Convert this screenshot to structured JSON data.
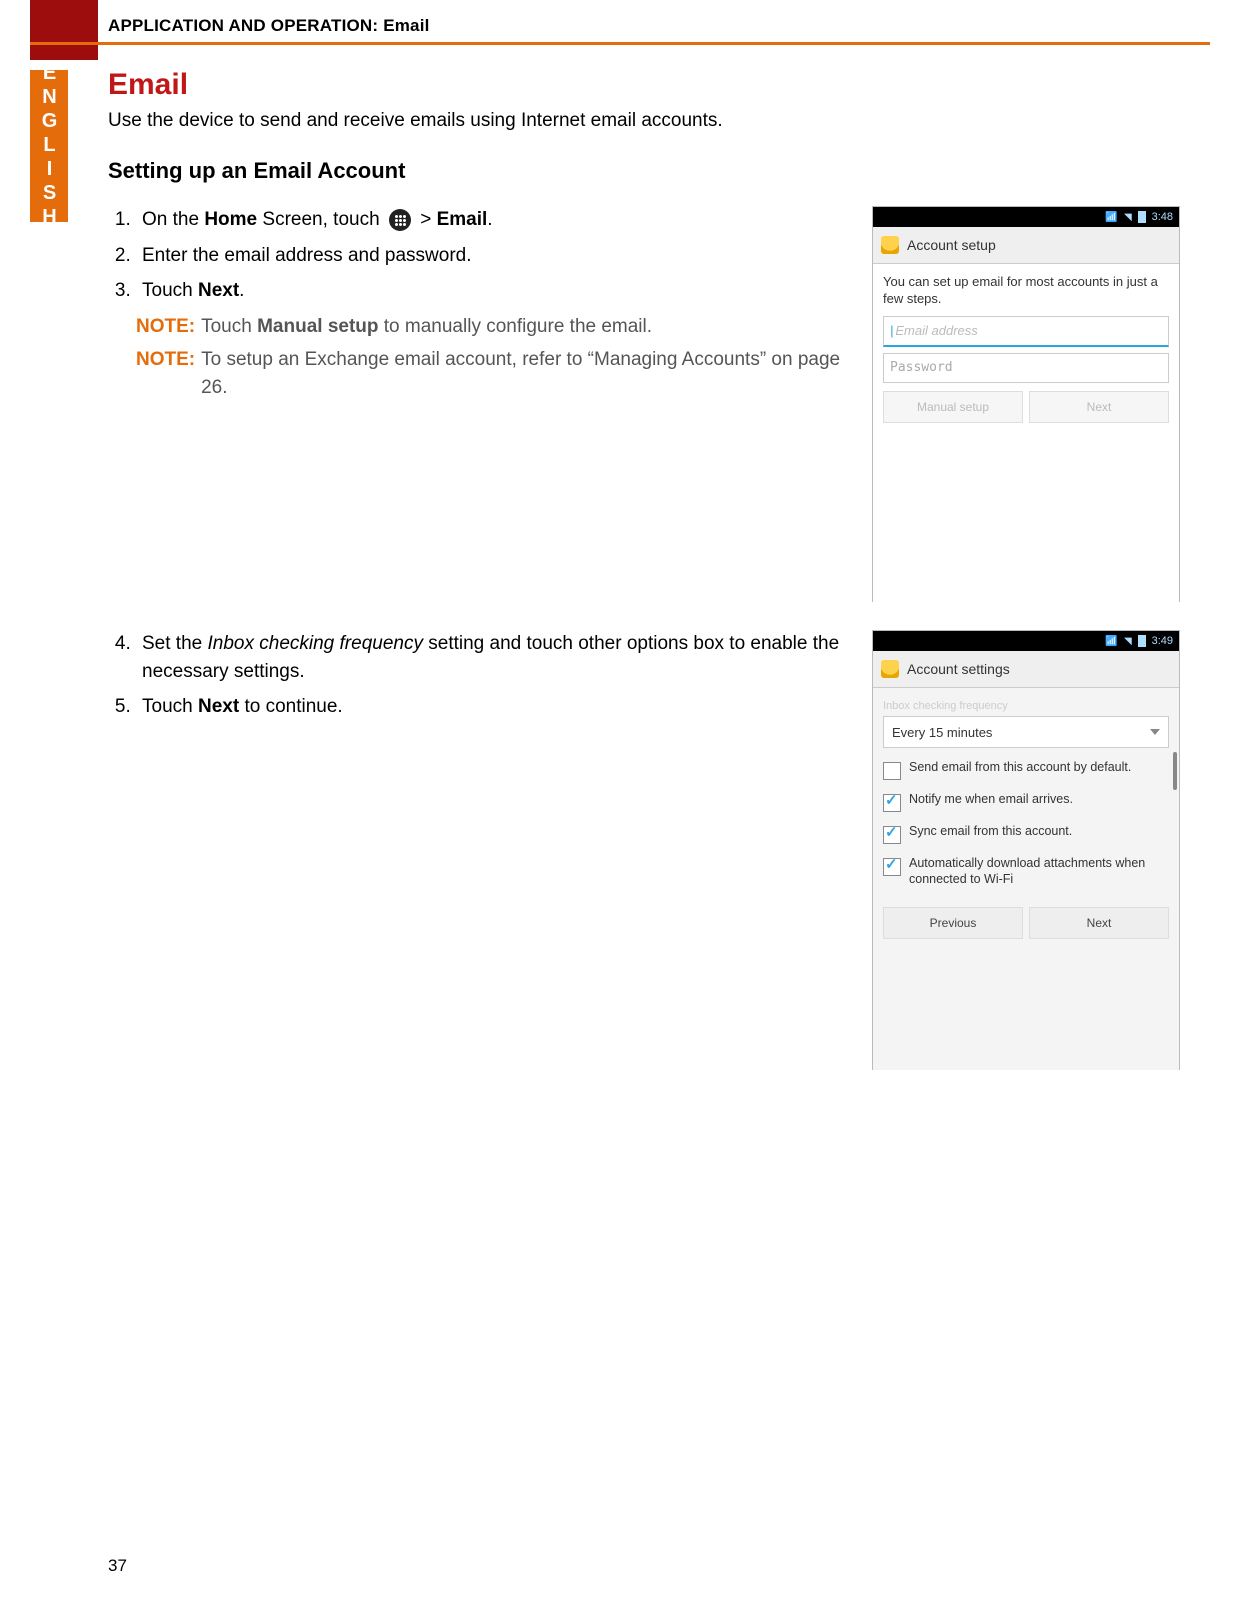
{
  "header": {
    "title": "APPLICATION AND OPERATION: Email",
    "lang_tab": "ENGLISH"
  },
  "page": {
    "h1": "Email",
    "intro": "Use the device to send and receive emails using Internet email accounts.",
    "h2": "Setting up an Email Account",
    "page_number": "37"
  },
  "steps_a": {
    "s1_pre": "On the ",
    "s1_home": "Home",
    "s1_mid": " Screen, touch ",
    "s1_gt": " > ",
    "s1_email": "Email",
    "s1_end": ".",
    "s2": "Enter the email address and password.",
    "s3_pre": "Touch ",
    "s3_next": "Next",
    "s3_end": "."
  },
  "notes": {
    "label": "NOTE:",
    "n1_pre": "Touch ",
    "n1_manual": "Manual setup",
    "n1_post": " to manually configure the email.",
    "n2": "To setup an Exchange email account, refer to “Managing Accounts” on page 26."
  },
  "steps_b": {
    "s4_pre": "Set the ",
    "s4_ital": "Inbox checking frequency",
    "s4_post": " setting and touch other options box to enable the necessary settings.",
    "s5_pre": "Touch ",
    "s5_next": "Next",
    "s5_post": " to continue."
  },
  "phone1": {
    "time": "3:48",
    "bar_title": "Account setup",
    "msg": "You can set up email for most accounts in just a few steps.",
    "email_ph": "Email address",
    "pwd_ph": "Password",
    "btn_manual": "Manual setup",
    "btn_next": "Next"
  },
  "phone2": {
    "time": "3:49",
    "bar_title": "Account settings",
    "section": "Inbox checking frequency",
    "dropdown": "Every 15 minutes",
    "opt1": "Send email from this account by default.",
    "opt2": "Notify me when email arrives.",
    "opt3": "Sync email from this account.",
    "opt4": "Automatically download attachments when connected to Wi-Fi",
    "btn_prev": "Previous",
    "btn_next": "Next"
  }
}
